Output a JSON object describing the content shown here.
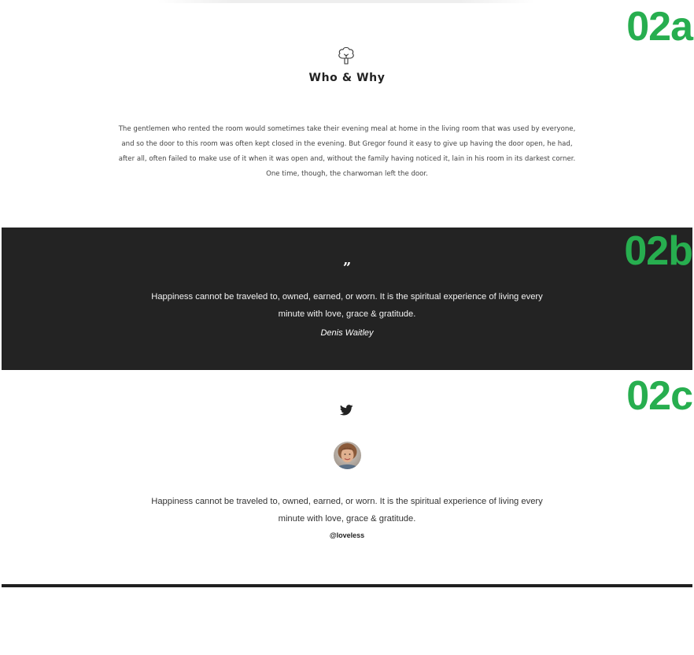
{
  "section_tags": {
    "a": "02a",
    "b": "02b",
    "c": "02c"
  },
  "colors": {
    "tag_green": "#27ae4f",
    "dark_band": "#232323",
    "bottom_rule": "#1f1f1f"
  },
  "who_why": {
    "icon": "tree-icon",
    "title": "Who & Why",
    "body": "The gentlemen who rented the room would sometimes take their evening meal at home in the living room that was used by everyone, and so the door to this room was often kept closed in the evening. But Gregor found it easy to give up having the door open, he had, after all, often failed to make use of it when it was open and, without the family having noticed it, lain in his room in its darkest corner. One time, though, the charwoman left the door."
  },
  "quote": {
    "icon": "quote-icon",
    "text": "Happiness cannot be traveled to, owned, earned, or worn. It is the spiritual experience of living every minute with love, grace & gratitude.",
    "author": "Denis Waitley"
  },
  "tweet": {
    "icon": "twitter-icon",
    "text": "Happiness cannot be traveled to, owned, earned, or worn. It is the spiritual experience of living every minute with love, grace & gratitude.",
    "handle": "@loveless"
  }
}
